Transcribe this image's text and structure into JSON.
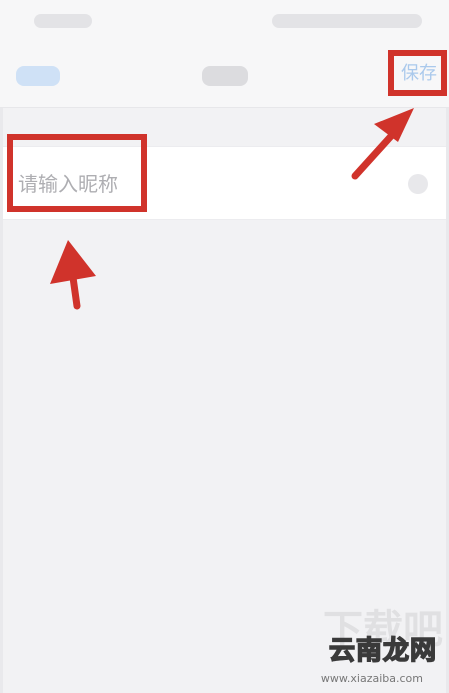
{
  "nav_bar": {
    "save_label": "保存"
  },
  "nickname": {
    "placeholder": "请输入昵称",
    "value": ""
  },
  "watermark": {
    "brand": "云南龙网",
    "brand_ghost": "下载吧",
    "url": "www.xiazaiba.com"
  },
  "colors": {
    "annotation_red": "#d0332b",
    "save_blue": "#aac9ec",
    "background": "#f2f2f4"
  }
}
